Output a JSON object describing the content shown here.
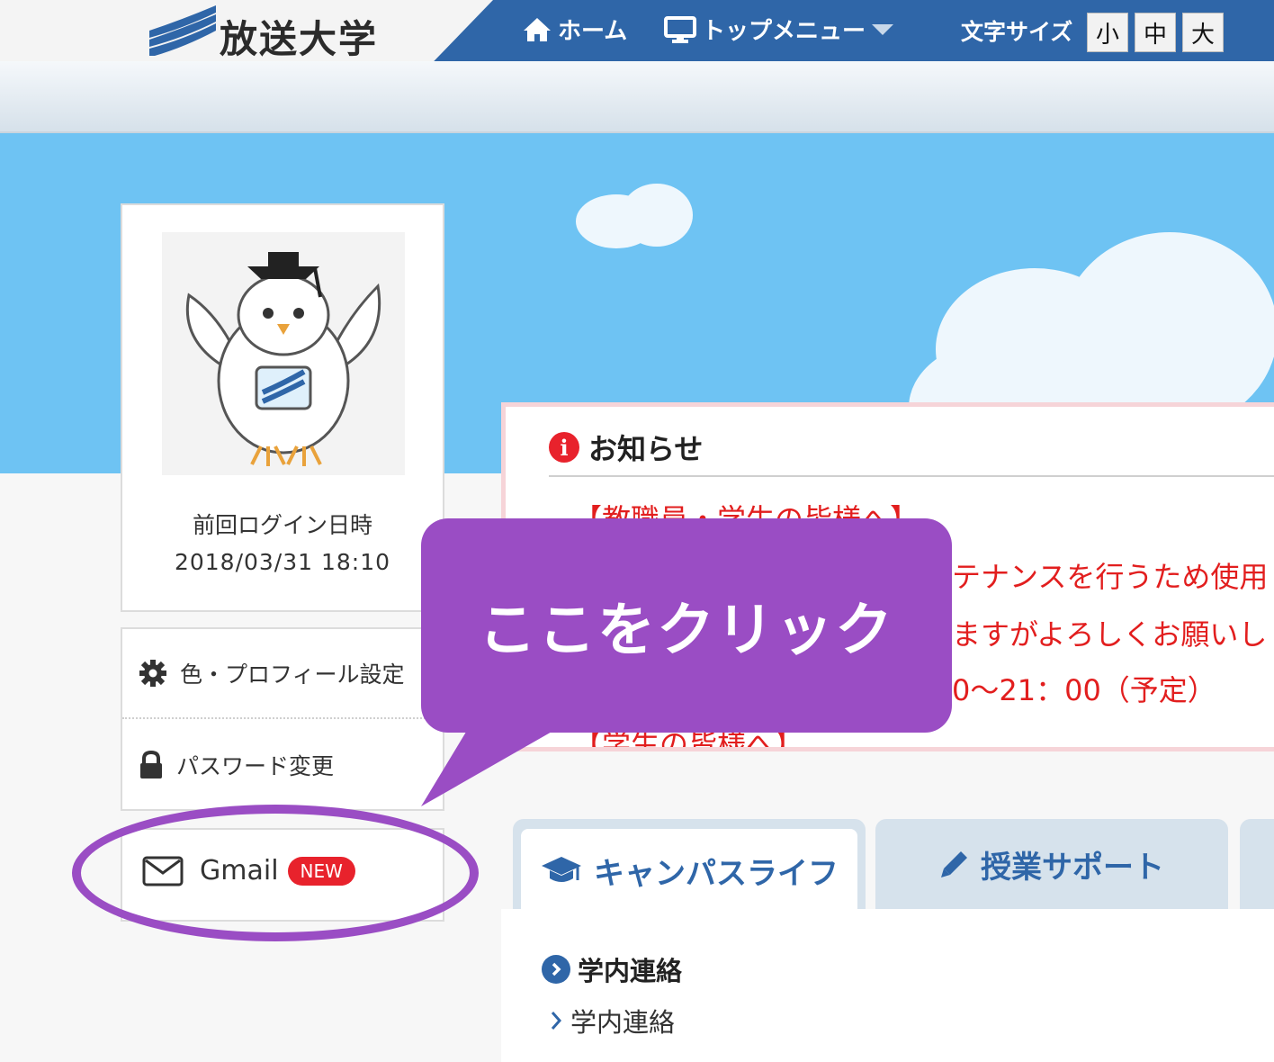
{
  "header": {
    "logo_text": "放送大学",
    "nav": {
      "home": "ホーム",
      "top_menu": "トップメニュー"
    },
    "font_size": {
      "label": "文字サイズ",
      "small": "小",
      "medium": "中",
      "large": "大"
    },
    "colors": {
      "bar": "#2f66a8",
      "logo_bg": "#f4f4f4"
    }
  },
  "profile": {
    "last_login_label": "前回ログイン日時",
    "last_login_time": "2018/03/31 18:10"
  },
  "side_menu": {
    "settings": "色・プロフィール設定",
    "password": "パスワード変更",
    "gmail": "Gmail",
    "gmail_badge": "NEW"
  },
  "notice": {
    "title": "お知らせ",
    "lines": [
      "【教職員・学生の皆様へ】",
      "テナンスを行うため使用",
      "ますがよろしくお願いし",
      "0～21：00（予定）",
      "【学生の皆様へ】"
    ],
    "color": "#e21e1e"
  },
  "callout": {
    "text": "ここをクリック",
    "color": "#9a4dc4"
  },
  "tabs": {
    "campus_life": "キャンパスライフ",
    "class_support": "授業サポート"
  },
  "section": {
    "heading": "学内連絡",
    "link": "学内連絡"
  }
}
